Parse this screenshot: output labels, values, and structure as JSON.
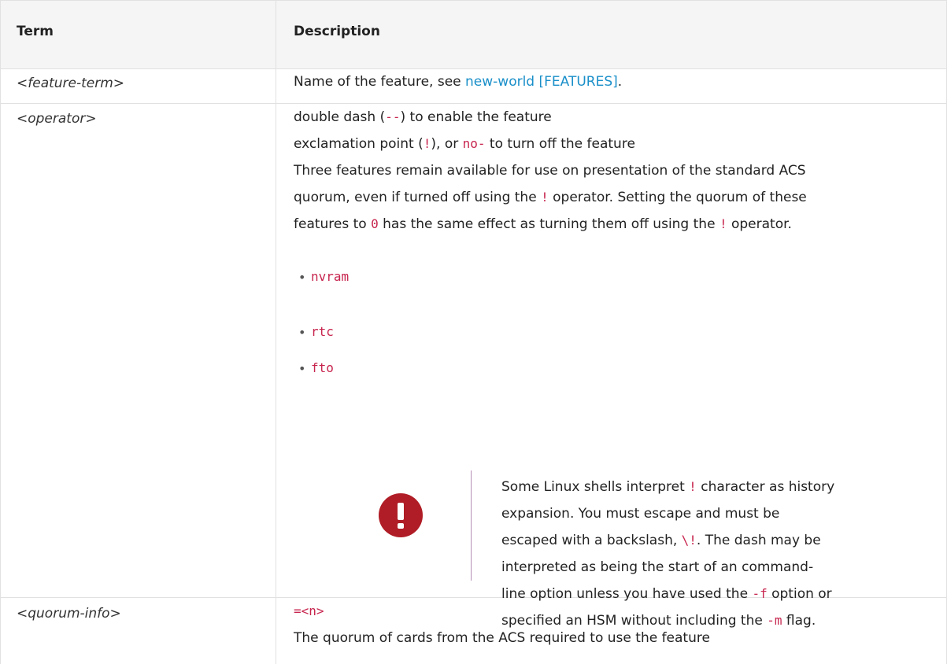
{
  "table": {
    "headers": {
      "term": "Term",
      "description": "Description"
    },
    "rows": [
      {
        "term": "<feature-term>",
        "desc_text": "Name of the feature, see ",
        "desc_link": "new-world [FEATURES]",
        "desc_after": "."
      },
      {
        "term": "<operator>",
        "line1": {
          "a": "double dash (",
          "code": "--",
          "b": ") to enable the feature"
        },
        "line2": {
          "a": "exclamation point (",
          "code1": "!",
          "b": "), or ",
          "code2": "no-",
          "c": " to turn off the feature"
        },
        "line3": "Three features remain available for use on presentation of the standard ACS",
        "line4": {
          "a": "quorum, even if turned off using the ",
          "code": "!",
          "b": " operator. Setting the quorum of these"
        },
        "line5": {
          "a": "features to ",
          "code1": "0",
          "b": " has the same effect as turning them off using the ",
          "code2": "!",
          "c": " operator."
        },
        "list": [
          "nvram",
          "rtc",
          "fto"
        ],
        "bullet": "•",
        "warning": {
          "icon": "exclamation-icon",
          "l1": {
            "a": "Some Linux shells interpret ",
            "code": "!",
            "b": " character as history"
          },
          "l2": "expansion. You must escape and must be",
          "l3": {
            "a": "escaped with a backslash, ",
            "code": "\\!",
            "b": ". The dash may be"
          },
          "l4": "interpreted as being the start of an command-",
          "l5": {
            "a": "line option unless you have used the ",
            "code": "-f",
            "b": " option or"
          },
          "l6": {
            "a": "specified an HSM without including the ",
            "code": "-m",
            "b": " flag."
          }
        }
      },
      {
        "term": "<quorum-info>",
        "code": "=<n>",
        "text": "The quorum of cards from the ACS required to use the feature"
      }
    ]
  },
  "colors": {
    "code": "#c7254e",
    "link": "#1a8fc9",
    "warning_icon": "#b01d26",
    "warning_bar": "#b58db6",
    "header_bg": "#f5f5f5",
    "border": "#e1e1e1"
  }
}
